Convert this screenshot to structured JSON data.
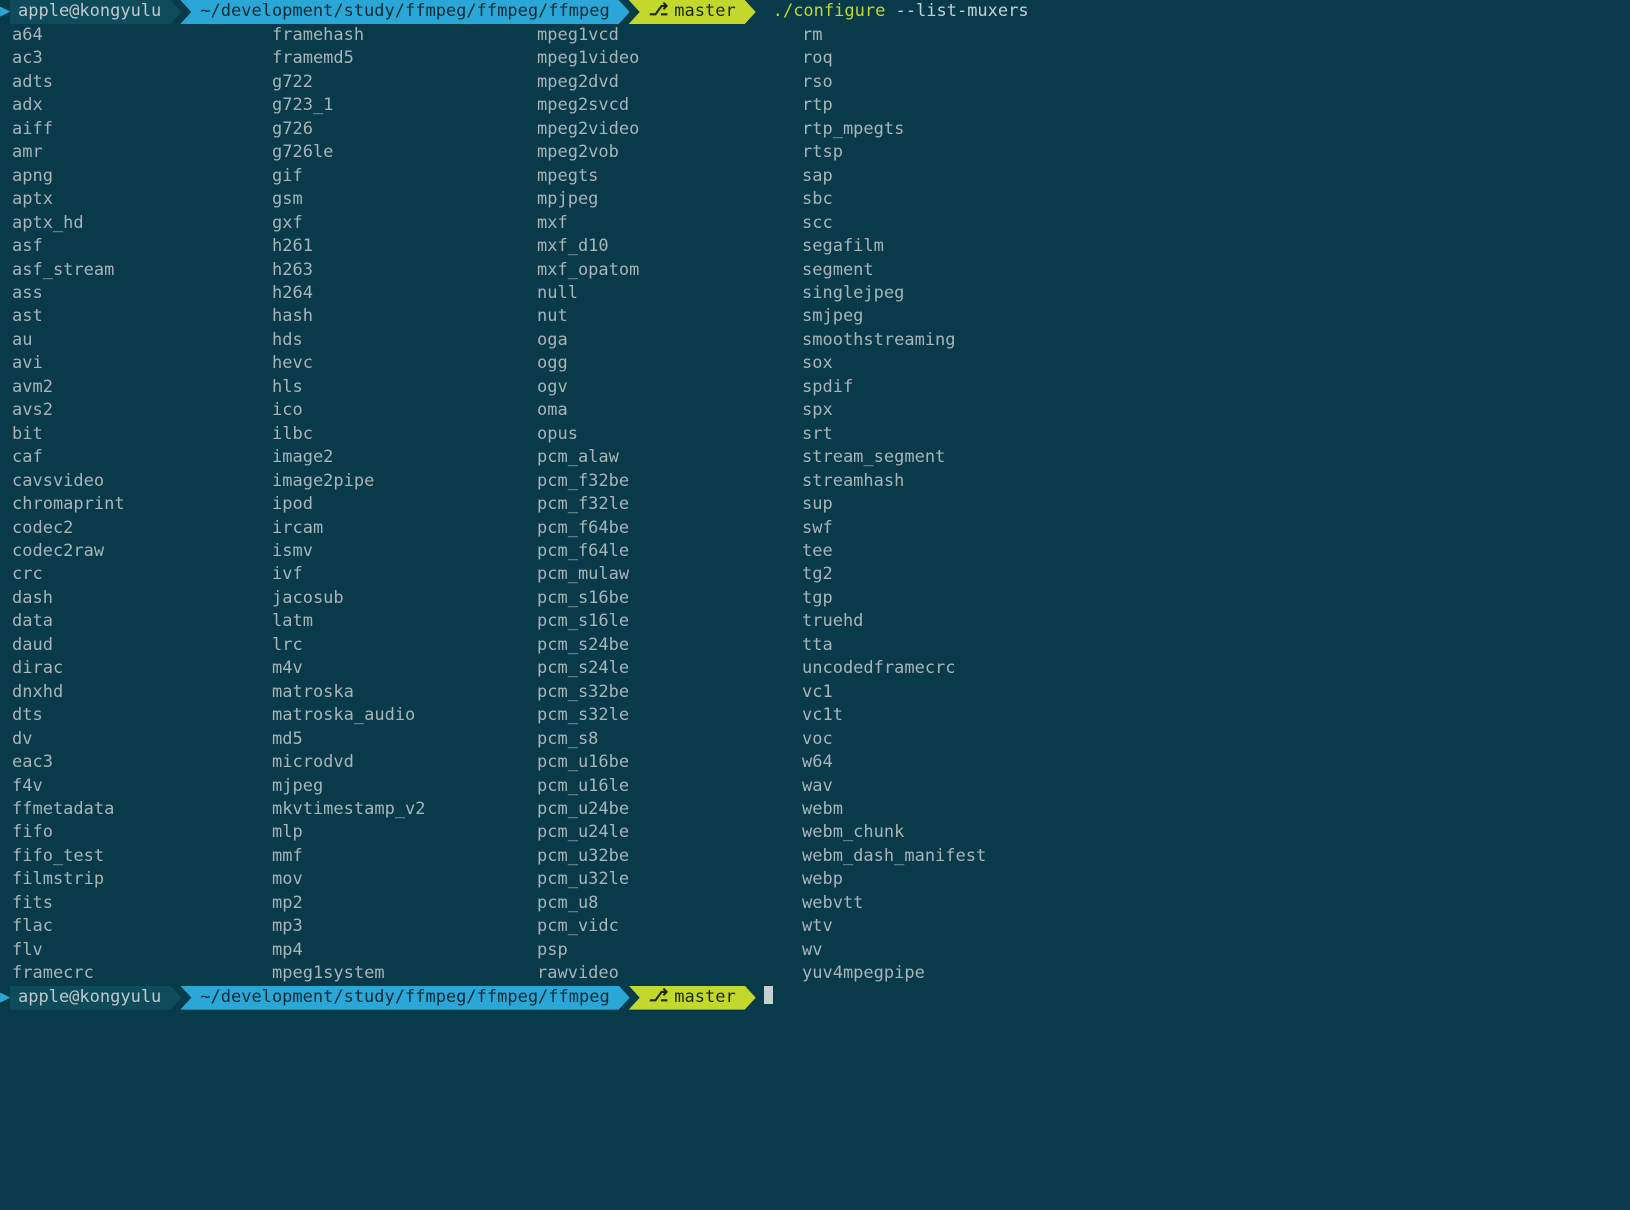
{
  "prompt1": {
    "user": "apple@kongyulu",
    "path": "~/development/study/ffmpeg/ffmpeg/ffmpeg",
    "branch": "master",
    "cmd_bin": "./configure",
    "cmd_args": " --list-muxers"
  },
  "prompt2": {
    "user": "apple@kongyulu",
    "path": "~/development/study/ffmpeg/ffmpeg/ffmpeg",
    "branch": "master"
  },
  "columns": [
    [
      "a64",
      "ac3",
      "adts",
      "adx",
      "aiff",
      "amr",
      "apng",
      "aptx",
      "aptx_hd",
      "asf",
      "asf_stream",
      "ass",
      "ast",
      "au",
      "avi",
      "avm2",
      "avs2",
      "bit",
      "caf",
      "cavsvideo",
      "chromaprint",
      "codec2",
      "codec2raw",
      "crc",
      "dash",
      "data",
      "daud",
      "dirac",
      "dnxhd",
      "dts",
      "dv",
      "eac3",
      "f4v",
      "ffmetadata",
      "fifo",
      "fifo_test",
      "filmstrip",
      "fits",
      "flac",
      "flv",
      "framecrc"
    ],
    [
      "framehash",
      "framemd5",
      "g722",
      "g723_1",
      "g726",
      "g726le",
      "gif",
      "gsm",
      "gxf",
      "h261",
      "h263",
      "h264",
      "hash",
      "hds",
      "hevc",
      "hls",
      "ico",
      "ilbc",
      "image2",
      "image2pipe",
      "ipod",
      "ircam",
      "ismv",
      "ivf",
      "jacosub",
      "latm",
      "lrc",
      "m4v",
      "matroska",
      "matroska_audio",
      "md5",
      "microdvd",
      "mjpeg",
      "mkvtimestamp_v2",
      "mlp",
      "mmf",
      "mov",
      "mp2",
      "mp3",
      "mp4",
      "mpeg1system"
    ],
    [
      "mpeg1vcd",
      "mpeg1video",
      "mpeg2dvd",
      "mpeg2svcd",
      "mpeg2video",
      "mpeg2vob",
      "mpegts",
      "mpjpeg",
      "mxf",
      "mxf_d10",
      "mxf_opatom",
      "null",
      "nut",
      "oga",
      "ogg",
      "ogv",
      "oma",
      "opus",
      "pcm_alaw",
      "pcm_f32be",
      "pcm_f32le",
      "pcm_f64be",
      "pcm_f64le",
      "pcm_mulaw",
      "pcm_s16be",
      "pcm_s16le",
      "pcm_s24be",
      "pcm_s24le",
      "pcm_s32be",
      "pcm_s32le",
      "pcm_s8",
      "pcm_u16be",
      "pcm_u16le",
      "pcm_u24be",
      "pcm_u24le",
      "pcm_u32be",
      "pcm_u32le",
      "pcm_u8",
      "pcm_vidc",
      "psp",
      "rawvideo"
    ],
    [
      "rm",
      "roq",
      "rso",
      "rtp",
      "rtp_mpegts",
      "rtsp",
      "sap",
      "sbc",
      "scc",
      "segafilm",
      "segment",
      "singlejpeg",
      "smjpeg",
      "smoothstreaming",
      "sox",
      "spdif",
      "spx",
      "srt",
      "stream_segment",
      "streamhash",
      "sup",
      "swf",
      "tee",
      "tg2",
      "tgp",
      "truehd",
      "tta",
      "uncodedframecrc",
      "vc1",
      "vc1t",
      "voc",
      "w64",
      "wav",
      "webm",
      "webm_chunk",
      "webm_dash_manifest",
      "webp",
      "webvtt",
      "wtv",
      "wv",
      "yuv4mpegpipe"
    ]
  ]
}
